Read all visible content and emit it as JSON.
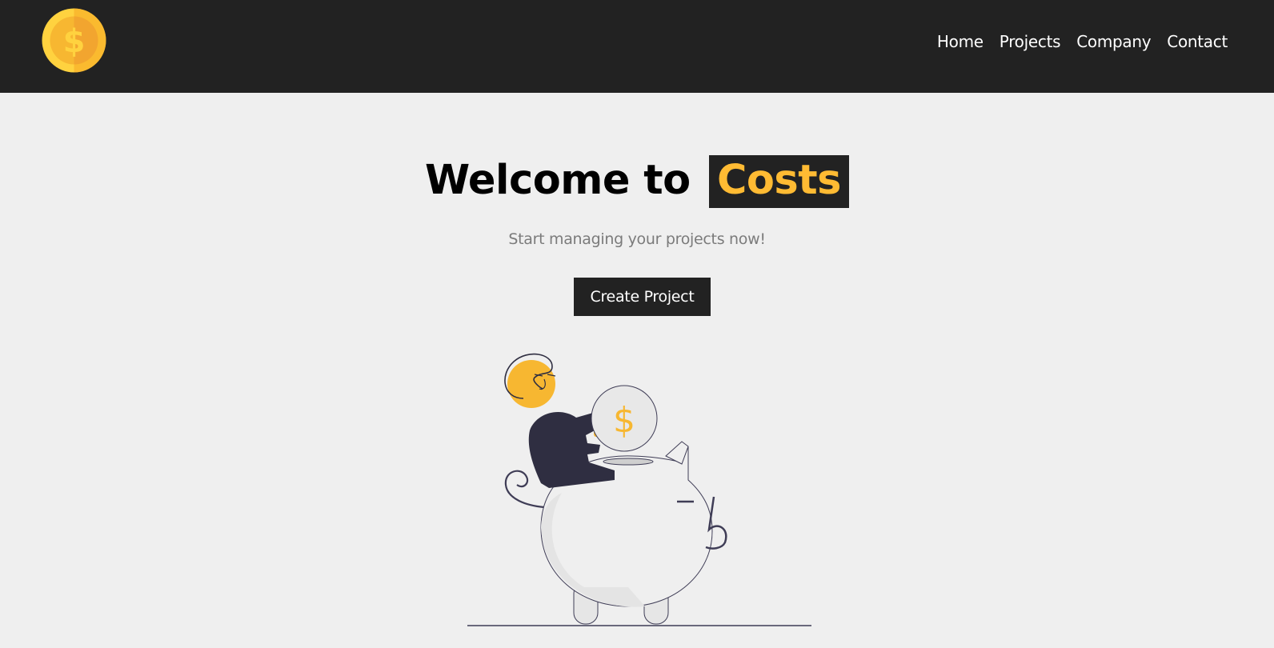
{
  "navbar": {
    "logo_icon": "dollar-coin-icon",
    "links": [
      {
        "label": "Home"
      },
      {
        "label": "Projects"
      },
      {
        "label": "Company"
      },
      {
        "label": "Contact"
      }
    ]
  },
  "hero": {
    "title_prefix": "Welcome to",
    "title_brand": "Costs",
    "subtitle": "Start managing your projects now!",
    "cta_label": "Create Project",
    "illustration": "piggy-bank-savings-illustration",
    "coin_symbol": "$"
  },
  "colors": {
    "nav_bg": "#222222",
    "page_bg": "#efefef",
    "accent": "#ffbb33",
    "subtitle": "#7b7b7b"
  }
}
